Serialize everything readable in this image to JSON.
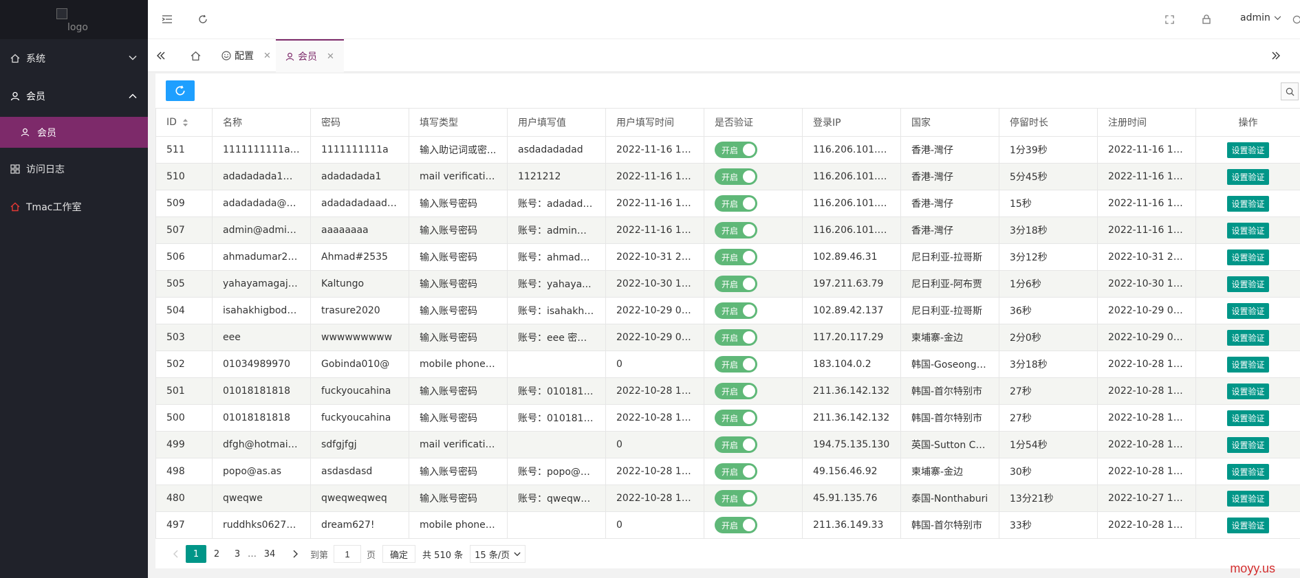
{
  "sidebar": {
    "logo_alt": "logo",
    "items": [
      {
        "label": "系统",
        "icon": "home-icon",
        "expanded": false
      },
      {
        "label": "会员",
        "icon": "member-icon",
        "expanded": true,
        "children": [
          {
            "label": "会员"
          }
        ]
      },
      {
        "label": "访问日志",
        "icon": "grid-icon"
      },
      {
        "label": "Tmac工作室",
        "icon": "house-red-icon"
      }
    ]
  },
  "topbar": {
    "user": "admin"
  },
  "tabs": [
    {
      "label": "配置"
    },
    {
      "label": "会员"
    }
  ],
  "table": {
    "headers": [
      "ID",
      "名称",
      "密码",
      "填写类型",
      "用户填写值",
      "用户填写时间",
      "是否验证",
      "登录IP",
      "国家",
      "停留时长",
      "注册时间",
      "操作"
    ],
    "switch_label": "开启",
    "action_label": "设置验证",
    "rows": [
      [
        "511",
        "1111111111a@...",
        "1111111111a",
        "输入助记词或密...",
        "asdadadadad",
        "2022-11-16 17:...",
        "116.206.101.158",
        "香港-灣仔",
        "1分39秒",
        "2022-11-16 17:..."
      ],
      [
        "510",
        "adadadada1@...",
        "adadadada1",
        "mail verification...",
        "1121212",
        "2022-11-16 16:...",
        "116.206.101.158",
        "香港-灣仔",
        "5分45秒",
        "2022-11-16 16:..."
      ],
      [
        "509",
        "adadadada@q...",
        "adadadadaada...",
        "输入账号密码",
        "账号：adadada...",
        "2022-11-16 16:...",
        "116.206.101.158",
        "香港-灣仔",
        "15秒",
        "2022-11-16 16:..."
      ],
      [
        "507",
        "admin@admin....",
        "aaaaaaaa",
        "输入账号密码",
        "账号：admin@...",
        "2022-11-16 14:...",
        "116.206.101.158",
        "香港-灣仔",
        "3分18秒",
        "2022-11-16 14:..."
      ],
      [
        "506",
        "ahmadumar20...",
        "Ahmad#2535",
        "输入账号密码",
        "账号：ahmadu...",
        "2022-10-31 21:...",
        "102.89.46.31",
        "尼日利亚-拉哥斯",
        "3分12秒",
        "2022-10-31 20:..."
      ],
      [
        "505",
        "yahayamagaji3...",
        "Kaltungo",
        "输入账号密码",
        "账号：yahaya...",
        "2022-10-30 13:...",
        "197.211.63.79",
        "尼日利亚-阿布贾",
        "1分6秒",
        "2022-10-30 13:..."
      ],
      [
        "504",
        "isahakhigbode...",
        "trasure2020",
        "输入账号密码",
        "账号：isahakhi...",
        "2022-10-29 01:...",
        "102.89.42.137",
        "尼日利亚-拉哥斯",
        "36秒",
        "2022-10-29 01:..."
      ],
      [
        "503",
        "eee",
        "wwwwwwwww",
        "输入账号密码",
        "账号：eee 密码...",
        "2022-10-29 01:...",
        "117.20.117.29",
        "柬埔寨-金边",
        "2分0秒",
        "2022-10-29 01:..."
      ],
      [
        "502",
        "01034989970",
        "Gobinda010@",
        "mobile phone v...",
        "",
        "0",
        "183.104.0.2",
        "韩国-Goseong-...",
        "3分18秒",
        "2022-10-28 19:..."
      ],
      [
        "501",
        "01018181818",
        "fuckyoucahina",
        "输入账号密码",
        "账号：0101818...",
        "2022-10-28 17:...",
        "211.36.142.132",
        "韩国-首尔特别市",
        "27秒",
        "2022-10-28 17:..."
      ],
      [
        "500",
        "01018181818",
        "fuckyoucahina",
        "输入账号密码",
        "账号：0101818...",
        "2022-10-28 17:...",
        "211.36.142.132",
        "韩国-首尔特别市",
        "27秒",
        "2022-10-28 17:..."
      ],
      [
        "499",
        "dfgh@hotmail.c...",
        "sdfgjfgj",
        "mail verification...",
        "",
        "0",
        "194.75.135.130",
        "英国-Sutton Co...",
        "1分54秒",
        "2022-10-28 17:..."
      ],
      [
        "498",
        "popo@as.as",
        "asdasdasd",
        "输入账号密码",
        "账号：popo@a...",
        "2022-10-28 17:...",
        "49.156.46.92",
        "柬埔寨-金边",
        "30秒",
        "2022-10-28 17:..."
      ],
      [
        "480",
        "qweqwe",
        "qweqweqweq",
        "输入账号密码",
        "账号：qweqwe ...",
        "2022-10-28 16:...",
        "45.91.135.76",
        "泰国-Nonthaburi",
        "13分21秒",
        "2022-10-27 15:..."
      ],
      [
        "497",
        "ruddhks0627@...",
        "dream627!",
        "mobile phone v...",
        "",
        "0",
        "211.36.149.33",
        "韩国-首尔特别市",
        "33秒",
        "2022-10-28 15:..."
      ]
    ]
  },
  "pager": {
    "pages": [
      "1",
      "2",
      "3"
    ],
    "ellipsis": "…",
    "last": "34",
    "goto_label": "到第",
    "goto_value": "1",
    "page_unit": "页",
    "confirm": "确定",
    "total": "共 510 条",
    "per_page": "15 条/页"
  },
  "watermark": "moyy.us"
}
